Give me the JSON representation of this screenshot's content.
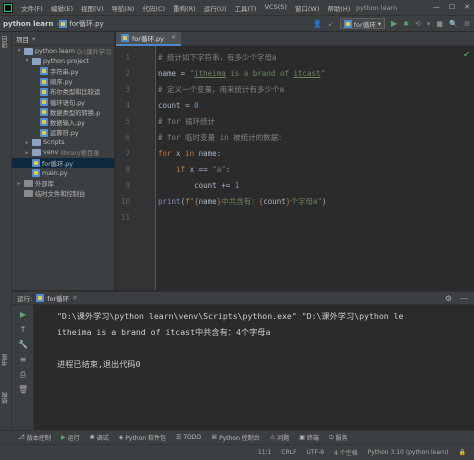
{
  "app": {
    "title": "python learn"
  },
  "menu": [
    "文件(F)",
    "编辑(E)",
    "视图(V)",
    "导航(N)",
    "代码(C)",
    "重构(R)",
    "运行(U)",
    "工具(T)",
    "VCS(S)",
    "窗口(W)",
    "帮助(H)"
  ],
  "window_title": "python learn",
  "breadcrumb": {
    "project": "python learn",
    "file": "for循环.py"
  },
  "run_config": "for循环",
  "left_tools": {
    "project": "项目",
    "bookmarks": "书签",
    "structure": "结构"
  },
  "project_panel": {
    "title": "项目",
    "tree": [
      {
        "indent": 0,
        "arrow": "▾",
        "icon": "folder",
        "label": "python learn",
        "hint": "D:\\课外学习"
      },
      {
        "indent": 1,
        "arrow": "▾",
        "icon": "folder",
        "label": "python project",
        "hint": ""
      },
      {
        "indent": 2,
        "arrow": "",
        "icon": "py",
        "label": "字符串.py",
        "hint": ""
      },
      {
        "indent": 2,
        "arrow": "",
        "icon": "py",
        "label": "顺序.py",
        "hint": ""
      },
      {
        "indent": 2,
        "arrow": "",
        "icon": "py",
        "label": "布尔类型和比较运",
        "hint": ""
      },
      {
        "indent": 2,
        "arrow": "",
        "icon": "py",
        "label": "循环语句.py",
        "hint": ""
      },
      {
        "indent": 2,
        "arrow": "",
        "icon": "py",
        "label": "数据类型的转换.p",
        "hint": ""
      },
      {
        "indent": 2,
        "arrow": "",
        "icon": "py",
        "label": "数据输入.py",
        "hint": ""
      },
      {
        "indent": 2,
        "arrow": "",
        "icon": "py",
        "label": "运算符.py",
        "hint": ""
      },
      {
        "indent": 1,
        "arrow": "▸",
        "icon": "folder",
        "label": "Scripts",
        "hint": ""
      },
      {
        "indent": 1,
        "arrow": "▸",
        "icon": "folder",
        "label": "venv",
        "hint": "library根目录"
      },
      {
        "indent": 1,
        "arrow": "",
        "icon": "py",
        "label": "for循环.py",
        "hint": "",
        "selected": true
      },
      {
        "indent": 1,
        "arrow": "",
        "icon": "py",
        "label": "main.py",
        "hint": ""
      },
      {
        "indent": 0,
        "arrow": "▸",
        "icon": "lib",
        "label": "外部库",
        "hint": ""
      },
      {
        "indent": 0,
        "arrow": "",
        "icon": "scratch",
        "label": "临时文件和控制台",
        "hint": ""
      }
    ]
  },
  "editor": {
    "tab_label": "for循环.py",
    "line_numbers": [
      "1",
      "2",
      "3",
      "4",
      "5",
      "6",
      "7",
      "8",
      "9",
      "10",
      "11"
    ]
  },
  "run_panel": {
    "label": "运行:",
    "tab": "for循环",
    "console": [
      "\"D:\\课外学习\\python learn\\venv\\Scripts\\python.exe\" \"D:\\课外学习\\python le",
      "itheima is a brand of itcast中共含有：4个字母a",
      "",
      "进程已结束,退出代码0"
    ]
  },
  "bottom_tools": [
    "版本控制",
    "运行",
    "调试",
    "Python 软件包",
    "TODO",
    "Python 控制台",
    "问题",
    "终端",
    "服务"
  ],
  "status": {
    "position": "11:1",
    "line_sep": "CRLF",
    "encoding": "UTF-8",
    "indent": "4 个空格",
    "interpreter": "Python 3.10 (python learn)"
  },
  "colors": {
    "keyword": "#cc7832",
    "string": "#6a8759",
    "number": "#6897bb",
    "comment": "#808080",
    "accent": "#4a88c7"
  }
}
